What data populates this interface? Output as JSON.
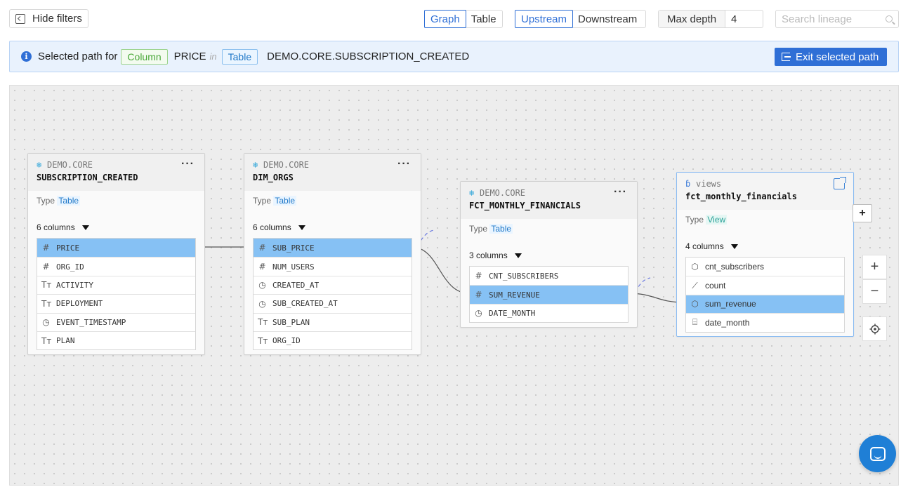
{
  "toolbar": {
    "hide_filters": "Hide filters",
    "view_tabs": [
      "Graph",
      "Table"
    ],
    "active_view": "Graph",
    "direction_tabs": [
      "Upstream",
      "Downstream"
    ],
    "active_direction": "Upstream",
    "max_depth_label": "Max depth",
    "max_depth_value": "4",
    "search_placeholder": "Search lineage"
  },
  "banner": {
    "prefix": "Selected path for",
    "column_tag": "Column",
    "column_name": "PRICE",
    "in_text": "in",
    "table_tag": "Table",
    "table_name": "DEMO.CORE.SUBSCRIPTION_CREATED",
    "exit_label": "Exit selected path",
    "colors": {
      "primary": "#2f6fd6",
      "banner_bg": "#e9f2fd"
    }
  },
  "nodes": [
    {
      "schema": "DEMO.CORE",
      "name": "SUBSCRIPTION_CREATED",
      "type_label": "Type",
      "type": "Table",
      "columns_label": "6 columns",
      "menu": "···",
      "icon": "snowflake-icon",
      "columns": [
        {
          "icon": "hash-icon",
          "name": "PRICE",
          "highlighted": true
        },
        {
          "icon": "hash-icon",
          "name": "ORG_ID"
        },
        {
          "icon": "text-icon",
          "name": "ACTIVITY"
        },
        {
          "icon": "text-icon",
          "name": "DEPLOYMENT"
        },
        {
          "icon": "clock-icon",
          "name": "EVENT_TIMESTAMP"
        },
        {
          "icon": "text-icon",
          "name": "PLAN"
        }
      ]
    },
    {
      "schema": "DEMO.CORE",
      "name": "DIM_ORGS",
      "type_label": "Type",
      "type": "Table",
      "columns_label": "6 columns",
      "menu": "···",
      "icon": "snowflake-icon",
      "columns": [
        {
          "icon": "hash-icon",
          "name": "SUB_PRICE",
          "highlighted": true
        },
        {
          "icon": "hash-icon",
          "name": "NUM_USERS"
        },
        {
          "icon": "clock-icon",
          "name": "CREATED_AT"
        },
        {
          "icon": "clock-icon",
          "name": "SUB_CREATED_AT"
        },
        {
          "icon": "text-icon",
          "name": "SUB_PLAN"
        },
        {
          "icon": "text-icon",
          "name": "ORG_ID"
        }
      ]
    },
    {
      "schema": "DEMO.CORE",
      "name": "FCT_MONTHLY_FINANCIALS",
      "type_label": "Type",
      "type": "Table",
      "columns_label": "3 columns",
      "menu": "···",
      "icon": "snowflake-icon",
      "columns": [
        {
          "icon": "hash-icon",
          "name": "CNT_SUBSCRIBERS"
        },
        {
          "icon": "hash-icon",
          "name": "SUM_REVENUE",
          "highlighted": true
        },
        {
          "icon": "clock-icon",
          "name": "DATE_MONTH"
        }
      ]
    },
    {
      "schema": "views",
      "name": "fct_monthly_financials",
      "type_label": "Type",
      "type": "View",
      "columns_label": "4 columns",
      "icon": "looker-icon",
      "columns": [
        {
          "icon": "cube-icon",
          "name": "cnt_subscribers"
        },
        {
          "icon": "ruler-icon",
          "name": "count"
        },
        {
          "icon": "cube-icon",
          "name": "sum_revenue",
          "highlighted": true
        },
        {
          "icon": "calendar-icon",
          "name": "date_month"
        }
      ]
    }
  ],
  "controls": {
    "expand": "+",
    "zoom_in": "+",
    "zoom_out": "−"
  }
}
